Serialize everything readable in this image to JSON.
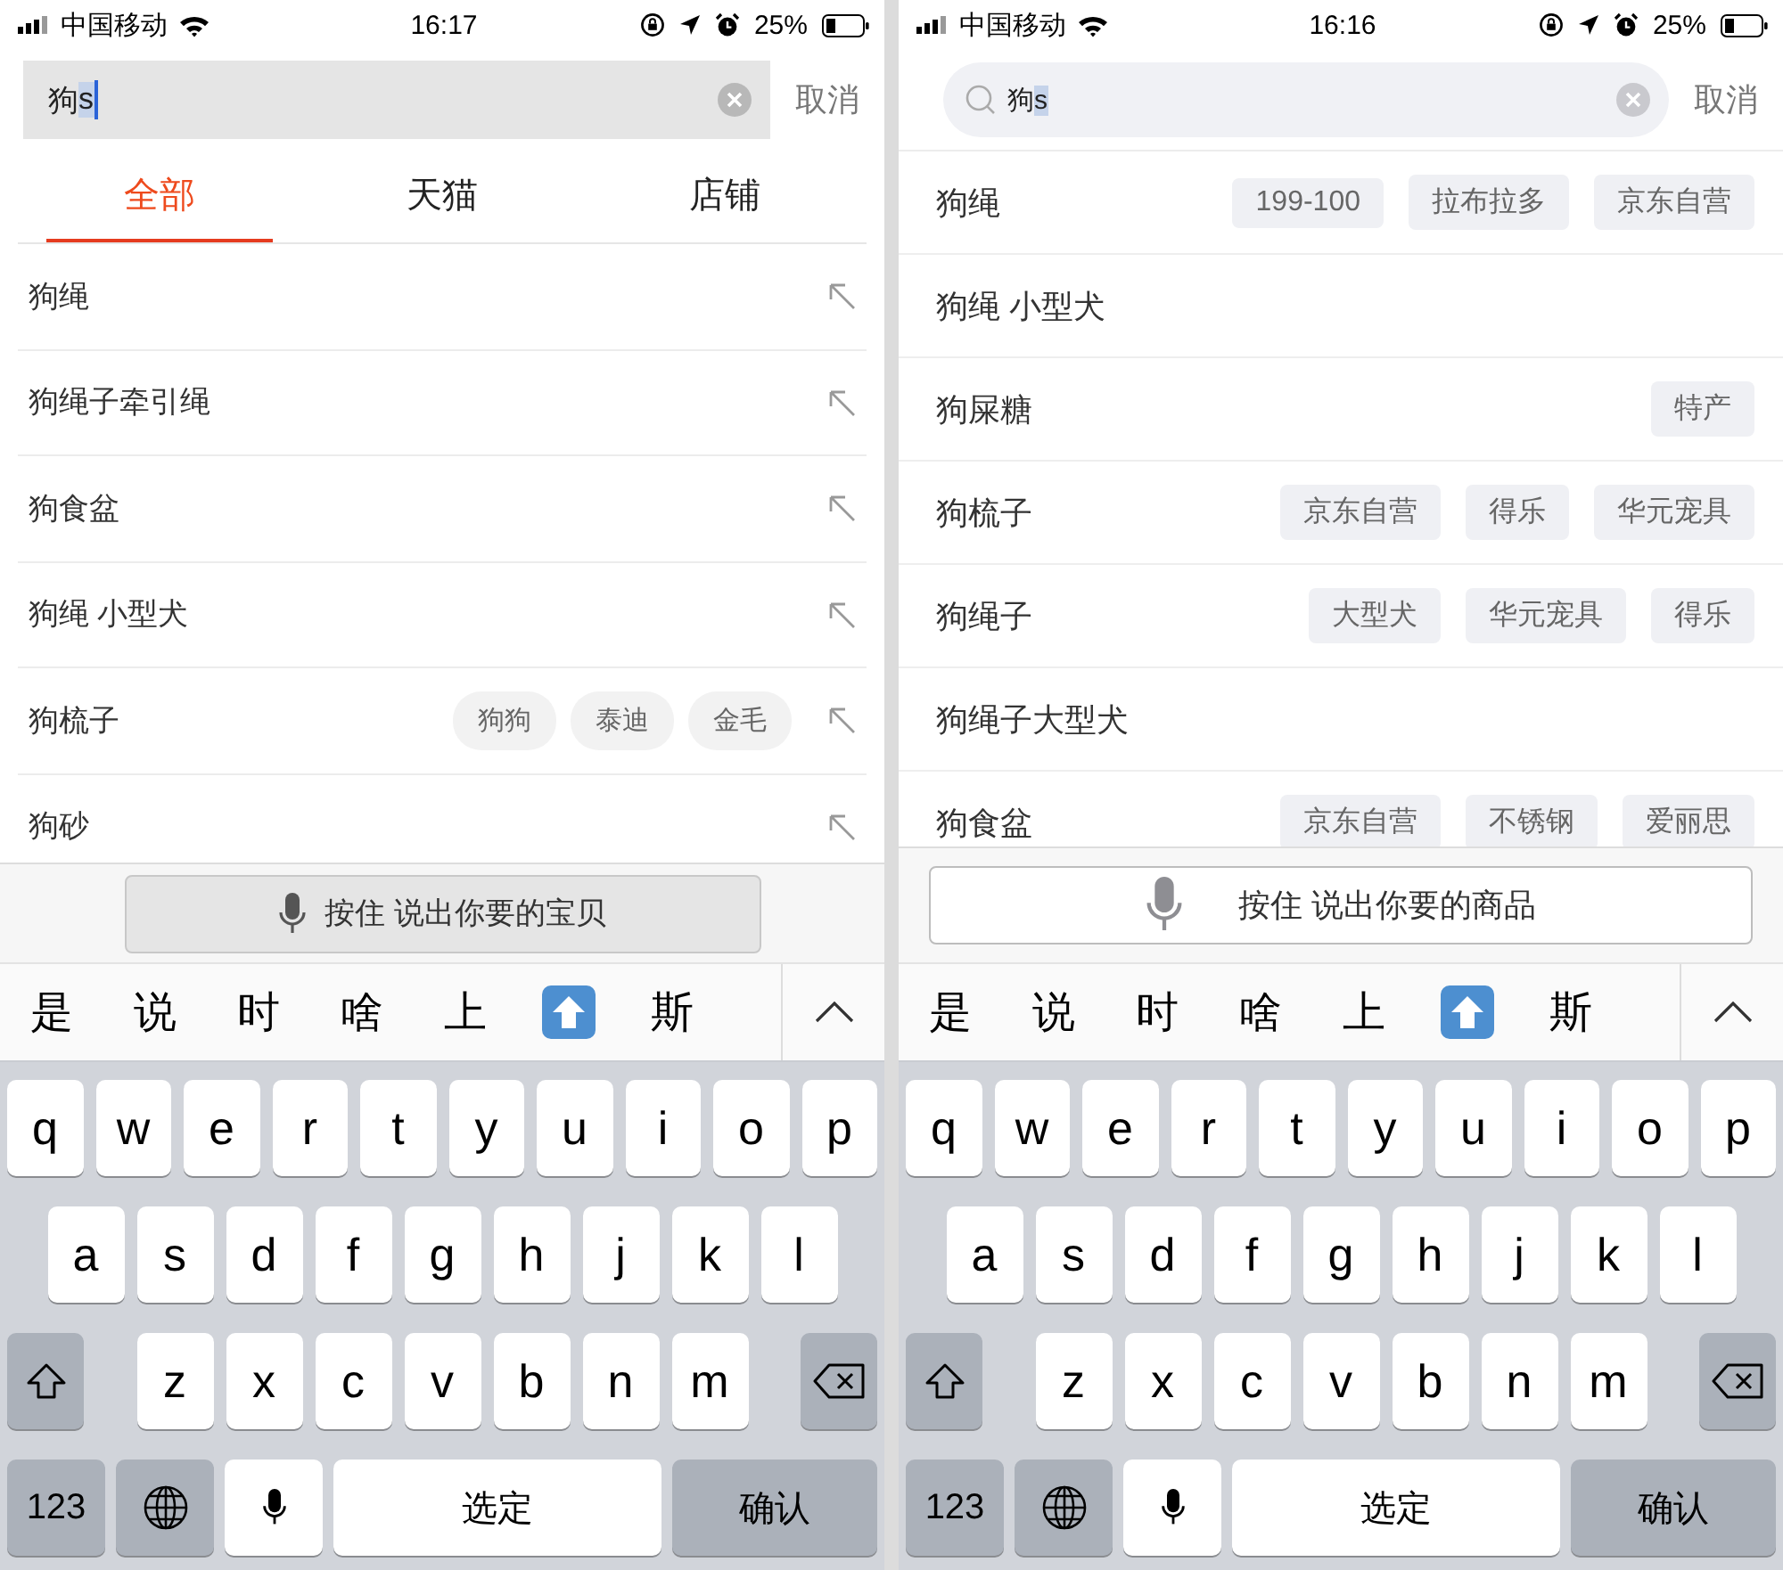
{
  "phones": [
    {
      "kind": "flat",
      "status": {
        "carrier": "中国移动",
        "time": "16:17",
        "battery": "25%"
      },
      "search": {
        "value": "狗",
        "marked": "s",
        "caret": true,
        "cancel": "取消"
      },
      "tabs": [
        {
          "label": "全部",
          "selected": true
        },
        {
          "label": "天猫",
          "selected": false
        },
        {
          "label": "店铺",
          "selected": false
        }
      ],
      "suggestions": [
        {
          "text": "狗绳",
          "arrow": true
        },
        {
          "text": "狗绳子牵引绳",
          "arrow": true
        },
        {
          "text": "狗食盆",
          "arrow": true
        },
        {
          "text": "狗绳 小型犬",
          "arrow": true
        },
        {
          "text": "狗梳子",
          "tags": [
            "狗狗",
            "泰迪",
            "金毛"
          ],
          "arrow": true
        },
        {
          "text": "狗砂",
          "arrow": true
        }
      ],
      "voice": {
        "label": "按住 说出你要的宝贝"
      },
      "candidates": [
        {
          "kind": "text",
          "text": "是"
        },
        {
          "kind": "text",
          "text": "说"
        },
        {
          "kind": "text",
          "text": "时"
        },
        {
          "kind": "text",
          "text": "啥"
        },
        {
          "kind": "text",
          "text": "上"
        },
        {
          "kind": "emoji"
        },
        {
          "kind": "text",
          "text": "斯"
        }
      ],
      "keyboard": {
        "row1": [
          "q",
          "w",
          "e",
          "r",
          "t",
          "y",
          "u",
          "i",
          "o",
          "p"
        ],
        "row2": [
          "a",
          "s",
          "d",
          "f",
          "g",
          "h",
          "j",
          "k",
          "l"
        ],
        "row3": [
          "z",
          "x",
          "c",
          "v",
          "b",
          "n",
          "m"
        ],
        "numbers": "123",
        "space": "选定",
        "confirm": "确认"
      }
    },
    {
      "kind": "rounded",
      "status": {
        "carrier": "中国移动",
        "time": "16:16",
        "battery": "25%"
      },
      "search": {
        "value": "狗",
        "marked": "s",
        "caret": false,
        "cancel": "取消"
      },
      "suggestions": [
        {
          "text": "狗绳",
          "tags": [
            "199-100",
            "拉布拉多",
            "京东自营"
          ],
          "arrow": false
        },
        {
          "text": "狗绳 小型犬",
          "arrow": false
        },
        {
          "text": "狗屎糖",
          "tags": [
            "特产"
          ],
          "arrow": false
        },
        {
          "text": "狗梳子",
          "tags": [
            "京东自营",
            "得乐",
            "华元宠具"
          ],
          "arrow": false
        },
        {
          "text": "狗绳子",
          "tags": [
            "大型犬",
            "华元宠具",
            "得乐"
          ],
          "arrow": false
        },
        {
          "text": "狗绳子大型犬",
          "arrow": false
        },
        {
          "text": "狗食盆",
          "tags": [
            "京东自营",
            "不锈钢",
            "爱丽思"
          ],
          "arrow": false
        }
      ],
      "voice": {
        "label": "按住 说出你要的商品"
      },
      "candidates": [
        {
          "kind": "text",
          "text": "是"
        },
        {
          "kind": "text",
          "text": "说"
        },
        {
          "kind": "text",
          "text": "时"
        },
        {
          "kind": "text",
          "text": "啥"
        },
        {
          "kind": "text",
          "text": "上"
        },
        {
          "kind": "emoji"
        },
        {
          "kind": "text",
          "text": "斯"
        }
      ],
      "keyboard": {
        "row1": [
          "q",
          "w",
          "e",
          "r",
          "t",
          "y",
          "u",
          "i",
          "o",
          "p"
        ],
        "row2": [
          "a",
          "s",
          "d",
          "f",
          "g",
          "h",
          "j",
          "k",
          "l"
        ],
        "row3": [
          "z",
          "x",
          "c",
          "v",
          "b",
          "n",
          "m"
        ],
        "numbers": "123",
        "space": "选定",
        "confirm": "确认"
      }
    }
  ]
}
